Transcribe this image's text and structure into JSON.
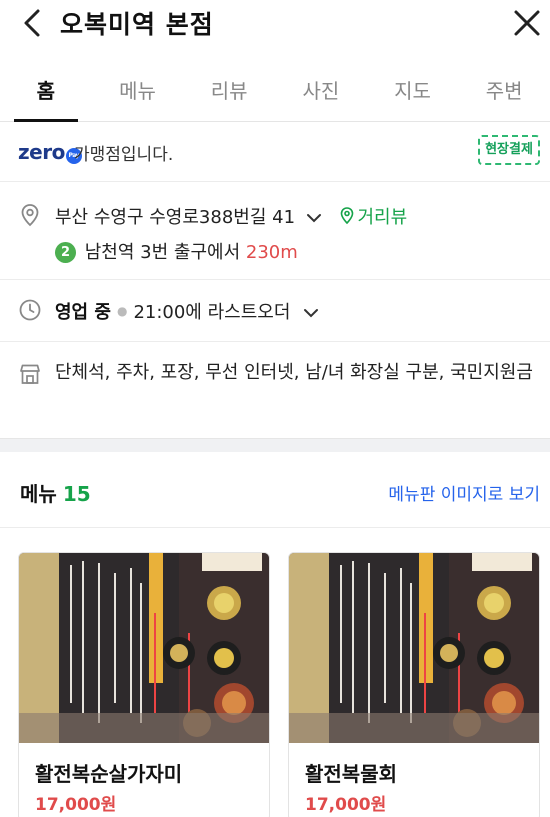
{
  "header": {
    "title": "오복미역 본점"
  },
  "tabs": [
    {
      "label": "홈",
      "active": true
    },
    {
      "label": "메뉴"
    },
    {
      "label": "리뷰"
    },
    {
      "label": "사진"
    },
    {
      "label": "지도"
    },
    {
      "label": "주변"
    }
  ],
  "zeropay": {
    "logo": "zero",
    "logo_badge": "Pay",
    "text": "가맹점입니다.",
    "badge": "현장결제"
  },
  "address": {
    "text": "부산 수영구 수영로388번길 41",
    "streetview": "거리뷰",
    "subway_line": "2",
    "subway_station": "남천역",
    "subway_exit": "3번 출구에서",
    "distance": "230m"
  },
  "hours": {
    "status": "영업 중",
    "detail": "21:00에 라스트오더"
  },
  "amenities": {
    "text": "단체석, 주차, 포장, 무선 인터넷, 남/녀 화장실 구분, 국민지원금"
  },
  "menu_section": {
    "title": "메뉴",
    "count": "15",
    "link": "메뉴판 이미지로 보기"
  },
  "menu_items": [
    {
      "name": "활전복순살가자미",
      "price": "17,000원"
    },
    {
      "name": "활전복물회",
      "price": "17,000원"
    }
  ],
  "colors": {
    "accent_green": "#16a34a",
    "link_blue": "#2563eb",
    "price_red": "#e04b4b"
  }
}
